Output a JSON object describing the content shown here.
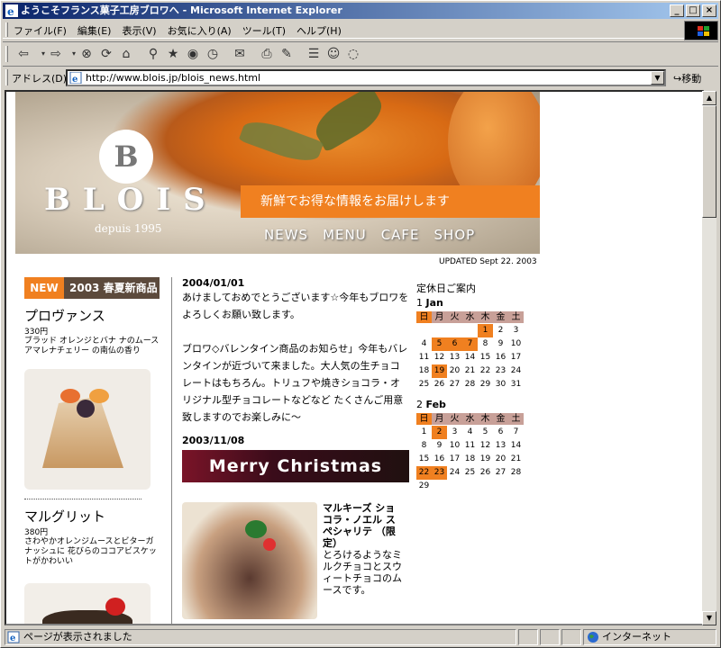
{
  "window": {
    "title": "ようこそフランス菓子工房ブロワへ - Microsoft Internet Explorer",
    "buttons": {
      "minimize": "_",
      "maximize": "□",
      "close": "×"
    }
  },
  "menu": {
    "items": [
      "ファイル(F)",
      "編集(E)",
      "表示(V)",
      "お気に入り(A)",
      "ツール(T)",
      "ヘルプ(H)"
    ]
  },
  "address": {
    "label": "アドレス(D)",
    "url": "http://www.blois.jp/blois_news.html",
    "go": "移動"
  },
  "status": {
    "text": "ページが表示されました",
    "zone": "インターネット"
  },
  "banner": {
    "logo_letter": "B",
    "logo_text": "BLOIS",
    "logo_sub": "depuis 1995",
    "tagline": "新鮮でお得な情報をお届けします",
    "nav": [
      "NEWS",
      "MENU",
      "CAFE",
      "SHOP"
    ],
    "updated": "UPDATED Sept 22. 2003"
  },
  "left": {
    "badge_new": "NEW",
    "badge_text": "2003 春夏新商品",
    "products": [
      {
        "name": "プロヴァンス",
        "price": "330円",
        "desc": "ブラッド オレンジとバナ ナのムース アマレナチェリー の南仏の香り"
      },
      {
        "name": "マルグリット",
        "price": "380円",
        "desc": "さわやかオレンジムースとビターガナッシュに 花びらのココアビスケットがかわいい"
      }
    ]
  },
  "news": {
    "items": [
      {
        "date": "2004/01/01",
        "text": "あけましておめでとうございます☆今年もブロワをよろしくお願い致します。"
      },
      {
        "date": "",
        "text": "ブロワ◇バレンタイン商品のお知らせ」今年もバレンタインが近づいて来ました。大人気の生チョコレートはもちろん。トリュフや焼きショコラ・オリジナル型チョコレートなどなど たくさんご用意致しますのでお楽しみに～"
      }
    ],
    "xmas_date": "2003/11/08",
    "xmas_banner": "Merry Christmas",
    "xmas_title": "マルキーズ ショコラ・ノエル スペシャリテ （限定）",
    "xmas_body": "とろけるようなミルクチョコとスウィートチョコのムースです。"
  },
  "calendar": {
    "title": "定休日ご案内",
    "weekdays": [
      "日",
      "月",
      "火",
      "水",
      "木",
      "金",
      "土"
    ],
    "months": [
      {
        "num": "1",
        "name": "Jan",
        "start": 4,
        "days": 31,
        "holidays": [
          1,
          5,
          6,
          7,
          19
        ]
      },
      {
        "num": "2",
        "name": "Feb",
        "start": 0,
        "days": 29,
        "holidays": [
          2,
          22,
          23
        ]
      }
    ]
  }
}
